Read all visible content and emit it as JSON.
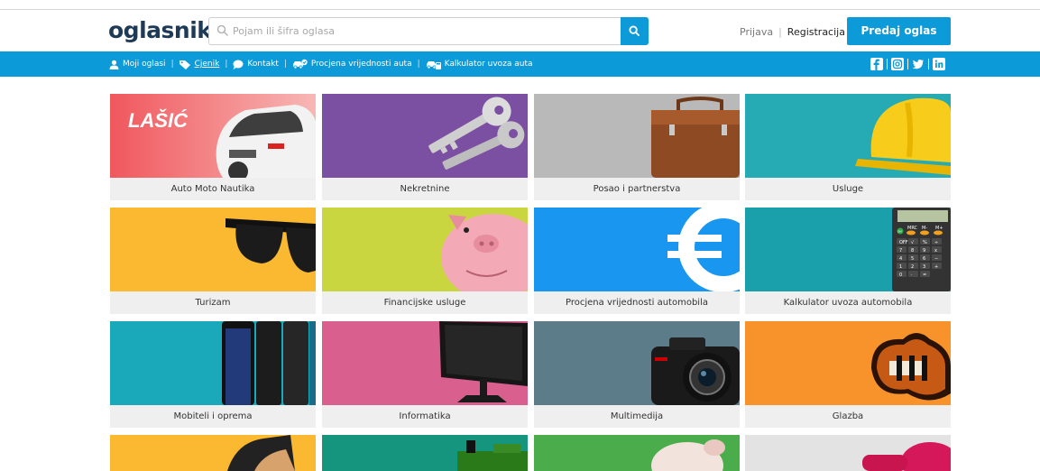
{
  "header": {
    "logo": "oglasnik",
    "search": {
      "placeholder": "Pojam ili šifra oglasa",
      "value": ""
    },
    "login": "Prijava",
    "separator": "|",
    "register": "Registracija",
    "post_ad": "Predaj oglas"
  },
  "nav": {
    "items": [
      {
        "label": "Moji oglasi",
        "icon": "user-icon"
      },
      {
        "label": "Cjenik",
        "icon": "tag-icon"
      },
      {
        "label": "Kontakt",
        "icon": "chat-icon"
      },
      {
        "label": "Procjena vrijednosti auta",
        "icon": "car-check-icon"
      },
      {
        "label": "Kalkulator uvoza auta",
        "icon": "car-calc-icon"
      }
    ],
    "separator": "|",
    "social": [
      "facebook-icon",
      "instagram-icon",
      "twitter-icon",
      "linkedin-icon"
    ]
  },
  "categories": [
    {
      "label": "Auto Moto Nautika",
      "brand_text": "LAŠIĆ"
    },
    {
      "label": "Nekretnine"
    },
    {
      "label": "Posao i partnerstva"
    },
    {
      "label": "Usluge"
    },
    {
      "label": "Turizam"
    },
    {
      "label": "Financijske usluge"
    },
    {
      "label": "Procjena vrijednosti automobila"
    },
    {
      "label": "Kalkulator uvoza automobila",
      "calc_keys": [
        "MRC",
        "M-",
        "M+",
        "OFF",
        "√",
        "%",
        "÷",
        "7",
        "8",
        "9",
        "x",
        "4",
        "5",
        "6",
        "−",
        "1",
        "2",
        "3",
        "+",
        "0",
        "·",
        "="
      ]
    },
    {
      "label": "Mobiteli i oprema"
    },
    {
      "label": "Informatika"
    },
    {
      "label": "Multimedija"
    },
    {
      "label": "Glazba"
    }
  ],
  "colors": {
    "brand_blue": "#0d9ad8",
    "logo_navy": "#1f3a57",
    "caption_bg": "#efefef"
  }
}
